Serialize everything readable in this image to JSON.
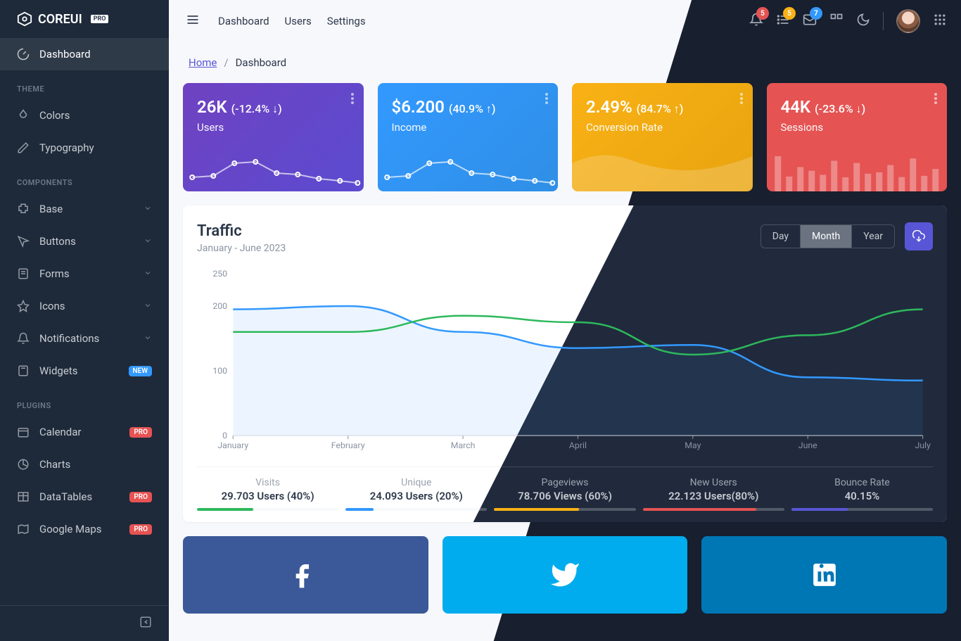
{
  "brand": {
    "name": "COREUI",
    "suffix": "PRO"
  },
  "sidebar": {
    "dashboard": "Dashboard",
    "sections": {
      "theme": "THEME",
      "components": "COMPONENTS",
      "plugins": "PLUGINS"
    },
    "theme": [
      {
        "label": "Colors",
        "icon": "drop"
      },
      {
        "label": "Typography",
        "icon": "pencil"
      }
    ],
    "components": [
      {
        "label": "Base",
        "icon": "puzzle",
        "expandable": true
      },
      {
        "label": "Buttons",
        "icon": "cursor",
        "expandable": true
      },
      {
        "label": "Forms",
        "icon": "notes",
        "expandable": true
      },
      {
        "label": "Icons",
        "icon": "star",
        "expandable": true
      },
      {
        "label": "Notifications",
        "icon": "bell",
        "expandable": true
      },
      {
        "label": "Widgets",
        "icon": "calculator",
        "badge": "NEW",
        "badge_type": "new"
      }
    ],
    "plugins": [
      {
        "label": "Calendar",
        "icon": "calendar",
        "badge": "PRO",
        "badge_type": "pro"
      },
      {
        "label": "Charts",
        "icon": "chart"
      },
      {
        "label": "DataTables",
        "icon": "table",
        "badge": "PRO",
        "badge_type": "pro"
      },
      {
        "label": "Google Maps",
        "icon": "map",
        "badge": "PRO",
        "badge_type": "pro"
      }
    ]
  },
  "header": {
    "nav": [
      "Dashboard",
      "Users",
      "Settings"
    ],
    "badges": {
      "bell": "5",
      "list": "5",
      "mail": "7"
    }
  },
  "breadcrumb": {
    "home": "Home",
    "current": "Dashboard"
  },
  "widgets": [
    {
      "value": "26K",
      "pct": "(-12.4% ↓)",
      "label": "Users",
      "color": "w1"
    },
    {
      "value": "$6.200",
      "pct": "(40.9% ↑)",
      "label": "Income",
      "color": "w2"
    },
    {
      "value": "2.49%",
      "pct": "(84.7% ↑)",
      "label": "Conversion Rate",
      "color": "w3"
    },
    {
      "value": "44K",
      "pct": "(-23.6% ↓)",
      "label": "Sessions",
      "color": "w4"
    }
  ],
  "traffic": {
    "title": "Traffic",
    "subtitle": "January - June 2023",
    "range": {
      "day": "Day",
      "month": "Month",
      "year": "Year",
      "active": "month"
    },
    "stats": [
      {
        "label": "Visits",
        "value": "29.703 Users (40%)",
        "pct": 40,
        "color": "#2eb85c"
      },
      {
        "label": "Unique",
        "value": "24.093 Users (20%)",
        "pct": 20,
        "color": "#3399ff"
      },
      {
        "label": "Pageviews",
        "value": "78.706 Views (60%)",
        "pct": 60,
        "color": "#f9b115"
      },
      {
        "label": "New Users",
        "value": "22.123 Users(80%)",
        "pct": 80,
        "color": "#e55353"
      },
      {
        "label": "Bounce Rate",
        "value": "40.15%",
        "pct": 40,
        "color": "#5856d6"
      }
    ]
  },
  "socials": [
    "facebook",
    "twitter",
    "linkedin"
  ],
  "chart_data": {
    "type": "line",
    "title": "Traffic",
    "xlabel": "",
    "ylabel": "",
    "ylim": [
      0,
      250
    ],
    "categories": [
      "January",
      "February",
      "March",
      "April",
      "May",
      "June",
      "July"
    ],
    "yticks": [
      0,
      100,
      200,
      250
    ],
    "series": [
      {
        "name": "blue",
        "color": "#3399ff",
        "values": [
          195,
          200,
          160,
          135,
          140,
          90,
          85
        ]
      },
      {
        "name": "green",
        "color": "#2eb85c",
        "values": [
          160,
          160,
          185,
          175,
          125,
          155,
          195
        ]
      }
    ]
  }
}
